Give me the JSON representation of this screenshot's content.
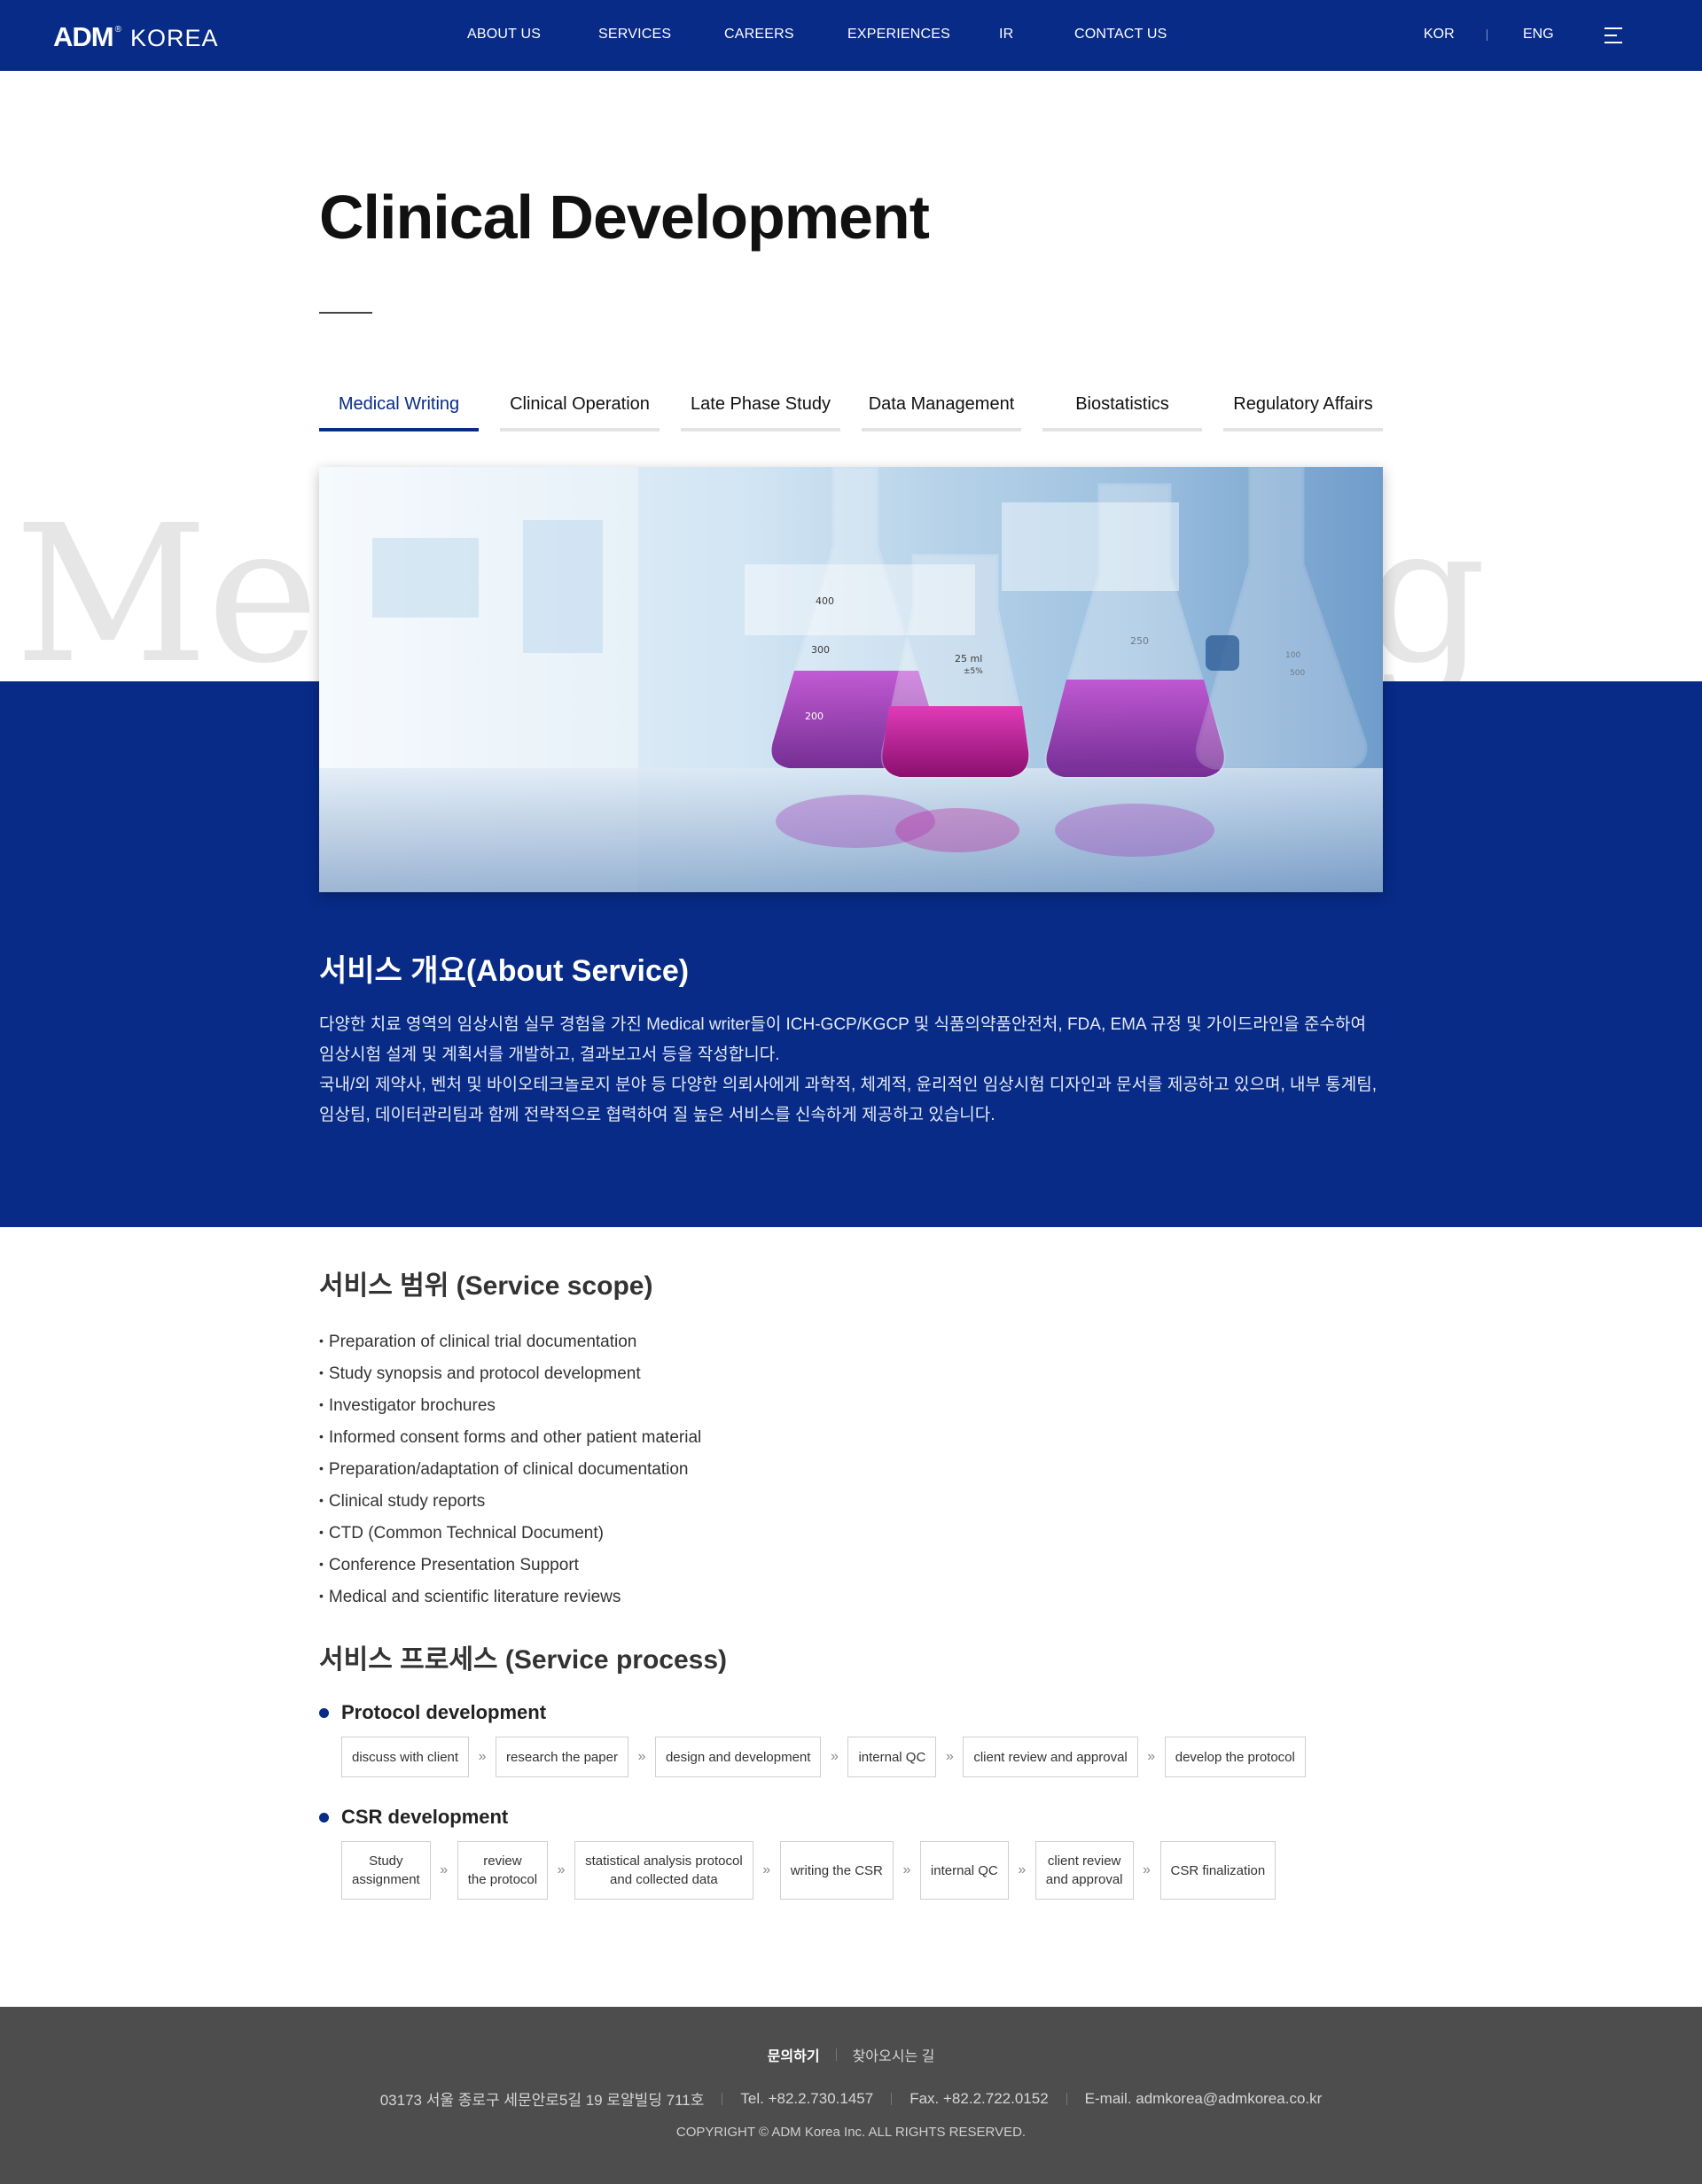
{
  "header": {
    "logo_main": "ADM",
    "logo_reg": "®",
    "logo_sub": "KOREA",
    "nav": [
      "ABOUT US",
      "SERVICES",
      "CAREERS",
      "EXPERIENCES",
      "IR",
      "CONTACT US"
    ],
    "lang": [
      "KOR",
      "ENG"
    ],
    "menu_icon": "hamburger-menu-icon",
    "bg_color": "#072b87"
  },
  "page": {
    "title": "Clinical Development",
    "background_word_left": "Me",
    "background_word_right": "ing"
  },
  "tabs": [
    {
      "label": "Medical Writing",
      "active": true
    },
    {
      "label": "Clinical Operation",
      "active": false
    },
    {
      "label": "Late Phase Study",
      "active": false
    },
    {
      "label": "Data Management",
      "active": false
    },
    {
      "label": "Biostatistics",
      "active": false
    },
    {
      "label": "Regulatory Affairs",
      "active": false
    }
  ],
  "hero": {
    "icon": "lab-flasks-photo",
    "flask_marks": [
      "400",
      "300",
      "200",
      "25 ml",
      "±5%",
      "250",
      "100",
      "500"
    ]
  },
  "about": {
    "title": "서비스 개요(About Service)",
    "paragraph1": "다양한 치료 영역의 임상시험 실무 경험을 가진 Medical writer들이 ICH-GCP/KGCP 및 식품의약품안전처, FDA, EMA 규정 및 가이드라인을 준수하여 임상시험 설계 및 계획서를 개발하고, 결과보고서 등을 작성합니다.",
    "paragraph2": "국내/외 제약사, 벤처 및 바이오테크놀로지 분야 등 다양한 의뢰사에게 과학적, 체계적, 윤리적인 임상시험 디자인과 문서를 제공하고 있으며, 내부 통계팀, 임상팀, 데이터관리팀과 함께 전략적으로 협력하여 질 높은 서비스를 신속하게 제공하고 있습니다."
  },
  "scope": {
    "title": "서비스 범위 (Service scope)",
    "items": [
      "Preparation of clinical trial documentation",
      "Study synopsis and protocol development",
      "Investigator brochures",
      "Informed consent forms and other patient material",
      "Preparation/adaptation of clinical documentation",
      "Clinical study reports",
      "CTD (Common Technical Document)",
      "Conference Presentation Support",
      "Medical and scientific literature reviews"
    ]
  },
  "process": {
    "title": "서비스 프로세스 (Service process)",
    "arrow_icon": "double-chevron-right-icon",
    "groups": [
      {
        "title": "Protocol development",
        "steps": [
          "discuss with client",
          "research the paper",
          "design and development",
          "internal QC",
          "client review and approval",
          "develop the protocol"
        ]
      },
      {
        "title": "CSR development",
        "steps": [
          "Study\nassignment",
          "review\nthe protocol",
          "statistical analysis protocol\nand collected data",
          "writing the CSR",
          "internal QC",
          "client review\nand approval",
          "CSR finalization"
        ]
      }
    ]
  },
  "footer": {
    "links": [
      "문의하기",
      "찾아오시는 길"
    ],
    "address": "03173 서울 종로구 세문안로5길 19 로얄빌딩 711호",
    "tel": "Tel. +82.2.730.1457",
    "fax": "Fax. +82.2.722.0152",
    "email": "E-mail. admkorea@admkorea.co.kr",
    "copyright": "COPYRIGHT © ADM Korea Inc. ALL RIGHTS RESERVED."
  }
}
